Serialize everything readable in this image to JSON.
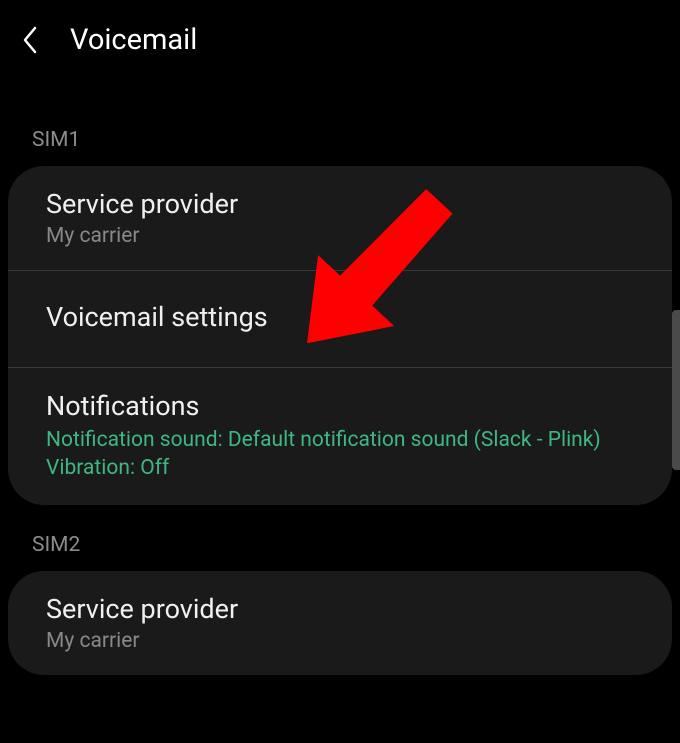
{
  "header": {
    "title": "Voicemail"
  },
  "sim1": {
    "label": "SIM1",
    "service_provider": {
      "title": "Service provider",
      "subtitle": "My carrier"
    },
    "voicemail_settings": {
      "title": "Voicemail settings"
    },
    "notifications": {
      "title": "Notifications",
      "sound_line": "Notification sound: Default notification sound (Slack - Plink)",
      "vibration_line": "Vibration: Off"
    }
  },
  "sim2": {
    "label": "SIM2",
    "service_provider": {
      "title": "Service provider",
      "subtitle": "My carrier"
    }
  }
}
